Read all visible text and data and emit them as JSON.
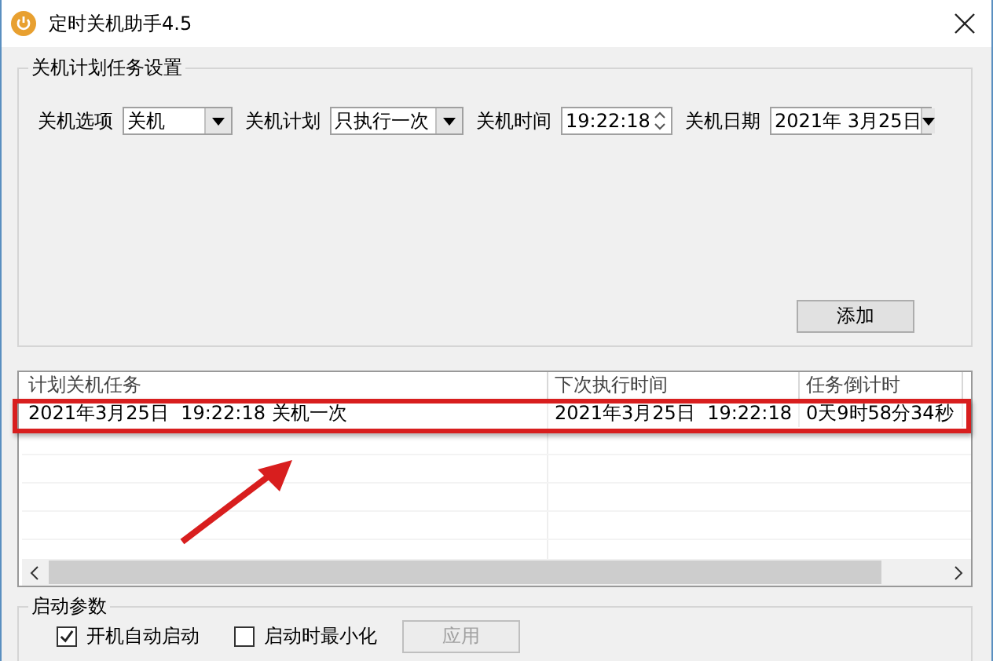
{
  "window": {
    "title": "定时关机助手4.5"
  },
  "schedule_group": {
    "title": "关机计划任务设置",
    "fields": [
      {
        "kind": "combo",
        "label": "关机选项",
        "value": "关机"
      },
      {
        "kind": "combo",
        "label": "关机计划",
        "value": "只执行一次"
      },
      {
        "kind": "spin",
        "label": "关机时间",
        "value": "19:22:18"
      },
      {
        "kind": "combo",
        "label": "关机日期",
        "value": "2021年 3月25日"
      }
    ],
    "add_button": "添加"
  },
  "task_table": {
    "columns": [
      "计划关机任务",
      "下次执行时间",
      "任务倒计时"
    ],
    "rows": [
      {
        "cells": [
          "2021年3月25日  19:22:18 关机一次",
          "2021年3月25日  19:22:18",
          "0天9时58分34秒"
        ]
      }
    ]
  },
  "startup_group": {
    "title": "启动参数",
    "options": [
      {
        "label": "开机自动启动",
        "checked": true
      },
      {
        "label": "启动时最小化",
        "checked": false
      }
    ],
    "apply_button": {
      "label": "应用",
      "disabled": true
    }
  }
}
